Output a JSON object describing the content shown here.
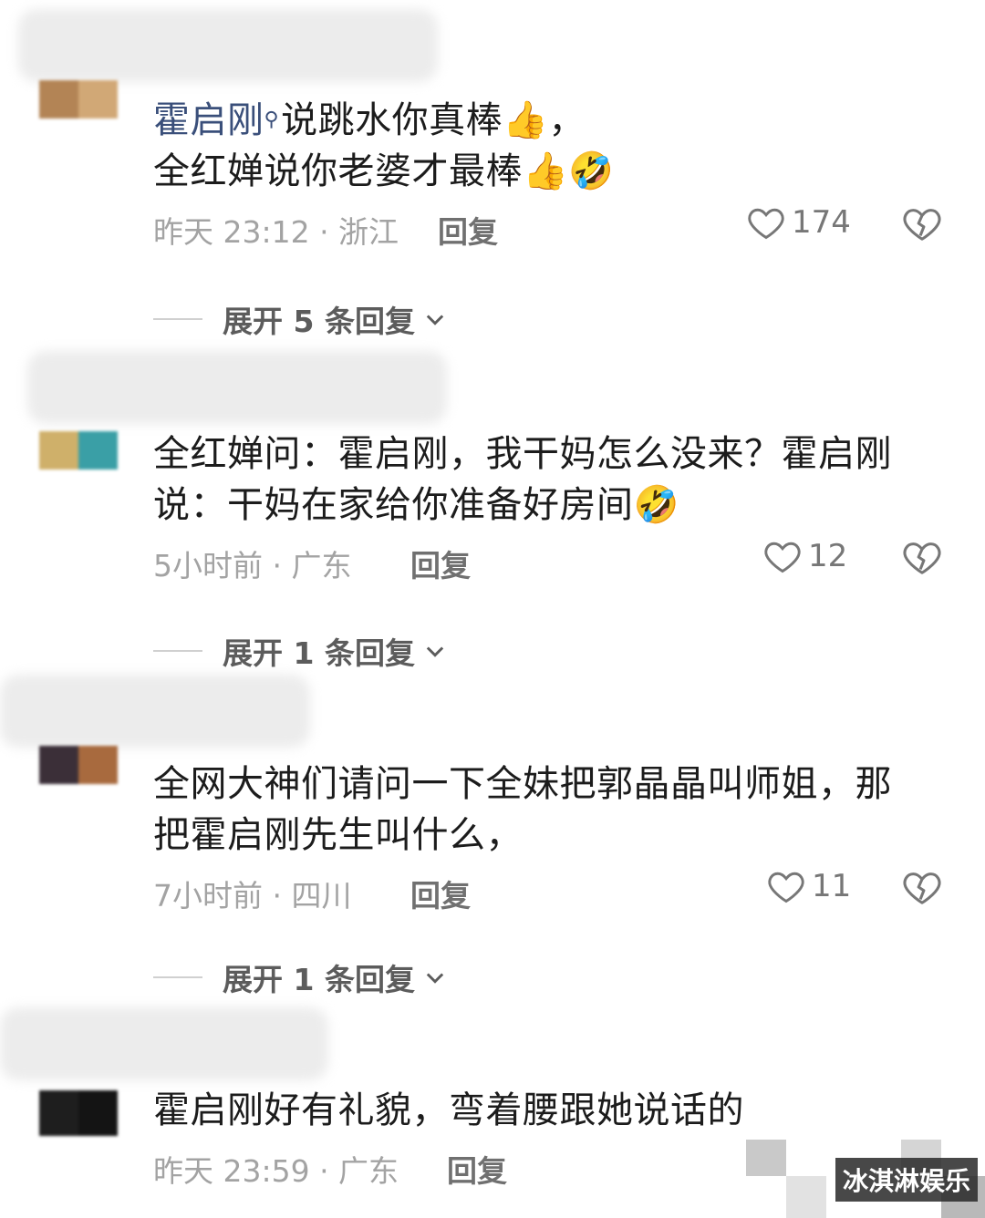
{
  "comments": [
    {
      "name_link": "霍启刚",
      "text_line1": "说跳水你真棒👍，",
      "text_line2": "全红婵说你老婆才最棒👍🤣",
      "time": "昨天 23:12 · 浙江",
      "reply": "回复",
      "likes": "174",
      "expand": "展开 5 条回复"
    },
    {
      "text_line1": "全红婵问：霍启刚，我干妈怎么没来？霍启刚",
      "text_line2": "说：干妈在家给你准备好房间🤣",
      "time": "5小时前 · 广东",
      "reply": "回复",
      "likes": "12",
      "expand": "展开 1 条回复"
    },
    {
      "text_line1": "全网大神们请问一下全妹把郭晶晶叫师姐，那",
      "text_line2": "把霍启刚先生叫什么，",
      "time": "7小时前 · 四川",
      "reply": "回复",
      "likes": "11",
      "expand": "展开 1 条回复"
    },
    {
      "text_line1": "霍启刚好有礼貌，弯着腰跟她说话的",
      "time": "昨天 23:59 · 广东",
      "reply": "回复"
    }
  ],
  "watermark": "冰淇淋娱乐",
  "icons": {
    "heart": "heart-outline-icon",
    "broken_heart": "broken-heart-icon",
    "chevron": "chevron-down-icon",
    "search": "search-icon"
  },
  "colors": {
    "name_link": "#3a4f7a",
    "meta_gray": "#a3a3a3"
  }
}
